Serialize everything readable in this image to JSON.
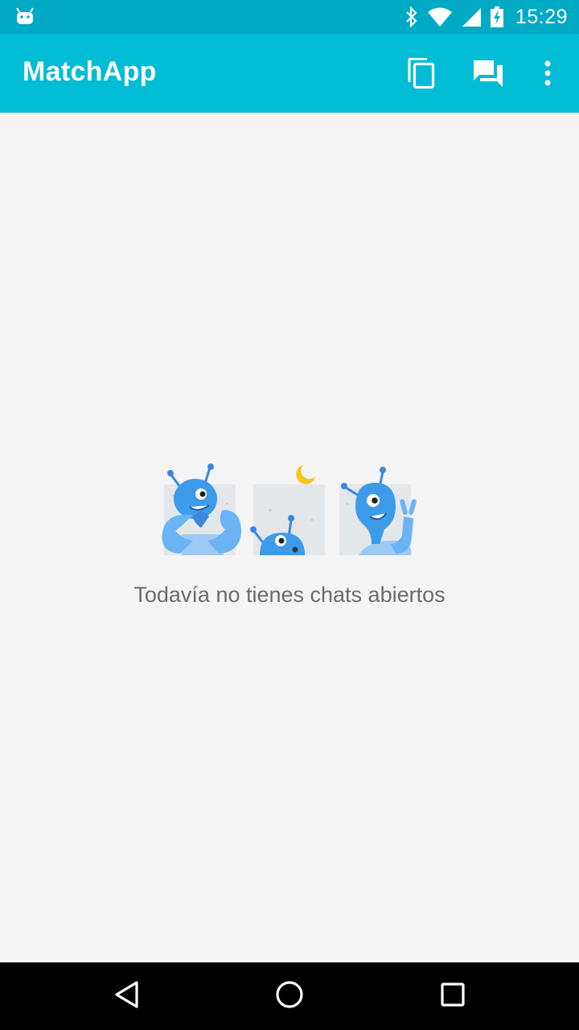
{
  "status_bar": {
    "time": "15:29",
    "icons": [
      "android-notification-icon",
      "bluetooth-icon",
      "wifi-icon",
      "cell-signal-icon",
      "battery-charging-icon"
    ]
  },
  "app_bar": {
    "title": "MatchApp",
    "actions": [
      "copy-cards-icon",
      "chat-bubbles-icon",
      "more-vert-icon"
    ],
    "color": "#00bcd4"
  },
  "empty_state": {
    "message": "Todavía no tienes chats abiertos",
    "illustration": "three-alien-mascots-illustration"
  },
  "navigation_bar": {
    "buttons": [
      "back-icon",
      "home-icon",
      "recents-icon"
    ]
  },
  "colors": {
    "status_bar": "#00a9c4",
    "accent": "#00bcd4",
    "background": "#f4f4f4",
    "mascot_blue": "#3d9be9",
    "moon": "#f5c518"
  }
}
